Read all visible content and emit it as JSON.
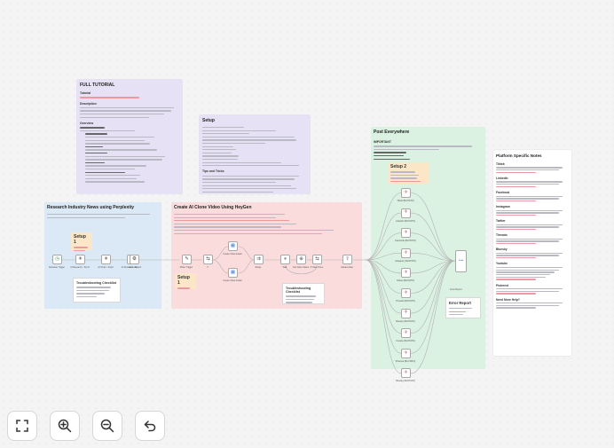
{
  "notes": {
    "tutorial": {
      "title": "FULL TUTORIAL",
      "sub1": "Tutorial",
      "sub2": "Description",
      "sub3": "Overview",
      "bg": "#e6e1f5"
    },
    "setup": {
      "title": "Setup",
      "sub": "Tips and Tricks",
      "bg": "#e6e1f5"
    },
    "research": {
      "title": "Research Industry News using Perplexity",
      "setup_label": "Setup 1",
      "checklist_title": "Troubleshooting Checklist",
      "bg": "#dbe8f5"
    },
    "video": {
      "title": "Create AI Clone Video Using HeyGen",
      "setup_label": "Setup 1",
      "checklist_title": "Troubleshooting Checklist",
      "bg": "#fadcdc"
    },
    "post": {
      "title": "Post Everywhere",
      "important": "IMPORTANT",
      "setup_label": "Setup 2",
      "bg": "#dbf1e2"
    },
    "error": {
      "title": "Error Report"
    },
    "platform": {
      "title": "Platform Specific Notes",
      "sections": [
        "Tiktok",
        "LinkedIn",
        "Facebook",
        "Instagram",
        "Twitter",
        "Threads",
        "Bluesky",
        "Youtube",
        "Pinterest",
        "Need More Help?"
      ],
      "bg": "#ffffff"
    }
  },
  "research_nodes": [
    {
      "name": "schedule-trigger-node",
      "label": "Schedule Trigger",
      "glyph": "◷"
    },
    {
      "name": "ai-research-node",
      "label": "AI Research - Top N",
      "glyph": "✳"
    },
    {
      "name": "ai-script-node",
      "label": "AI Script - Script",
      "glyph": "✳"
    },
    {
      "name": "ai-research-report-node",
      "label": "AI Research - Report",
      "glyph": "✳"
    },
    {
      "name": "generate-node",
      "label": "Generate",
      "glyph": "⚙"
    }
  ],
  "video_nodes": [
    {
      "name": "writer-trigger-node",
      "label": "Writer Trigger",
      "glyph": "✎"
    },
    {
      "name": "if-node",
      "label": "If",
      "glyph": "⇆"
    },
    {
      "name": "create-video-node-1",
      "label": "Create Video Avatar",
      "glyph": "▦"
    },
    {
      "name": "create-video-node-2",
      "label": "Create Video Avatar",
      "glyph": "▦"
    },
    {
      "name": "merge-node",
      "label": "Merge",
      "glyph": "⇉"
    },
    {
      "name": "wait-node",
      "label": "Wait",
      "glyph": "⏸"
    },
    {
      "name": "get-video-status-node",
      "label": "Get Video Status",
      "glyph": "⊕"
    },
    {
      "name": "if-video-done-node",
      "label": "If Video Done",
      "glyph": "⇆"
    },
    {
      "name": "upload-video-node",
      "label": "Upload video",
      "glyph": "⇪"
    }
  ],
  "post_nodes": [
    {
      "label": "Tiktok (BLOTATO)"
    },
    {
      "label": "LinkedIn (BLOTATO)"
    },
    {
      "label": "Facebook (BLOTATO)"
    },
    {
      "label": "Instagram (BLOTATO)"
    },
    {
      "label": "Twitter (BLOTATO)"
    },
    {
      "label": "Threads (BLOTATO)"
    },
    {
      "label": "Bluesky (BLOTATO)"
    },
    {
      "label": "Youtube (BLOTATO)"
    },
    {
      "label": "Pinterest (BLOTATO)"
    },
    {
      "label": "Bluesky (BLOTATO)"
    }
  ],
  "merge_node": {
    "label": "Error Report",
    "glyph": "⊶"
  },
  "controls": [
    {
      "name": "fit-view-button",
      "icon": "fullscreen-icon"
    },
    {
      "name": "zoom-in-button",
      "icon": "zoom-in-icon"
    },
    {
      "name": "zoom-out-button",
      "icon": "zoom-out-icon"
    },
    {
      "name": "undo-button",
      "icon": "undo-icon"
    }
  ],
  "colors": {
    "edge": "#b3b3b3",
    "accent_red": "#e05b66",
    "node_border": "#a8a8a8"
  }
}
